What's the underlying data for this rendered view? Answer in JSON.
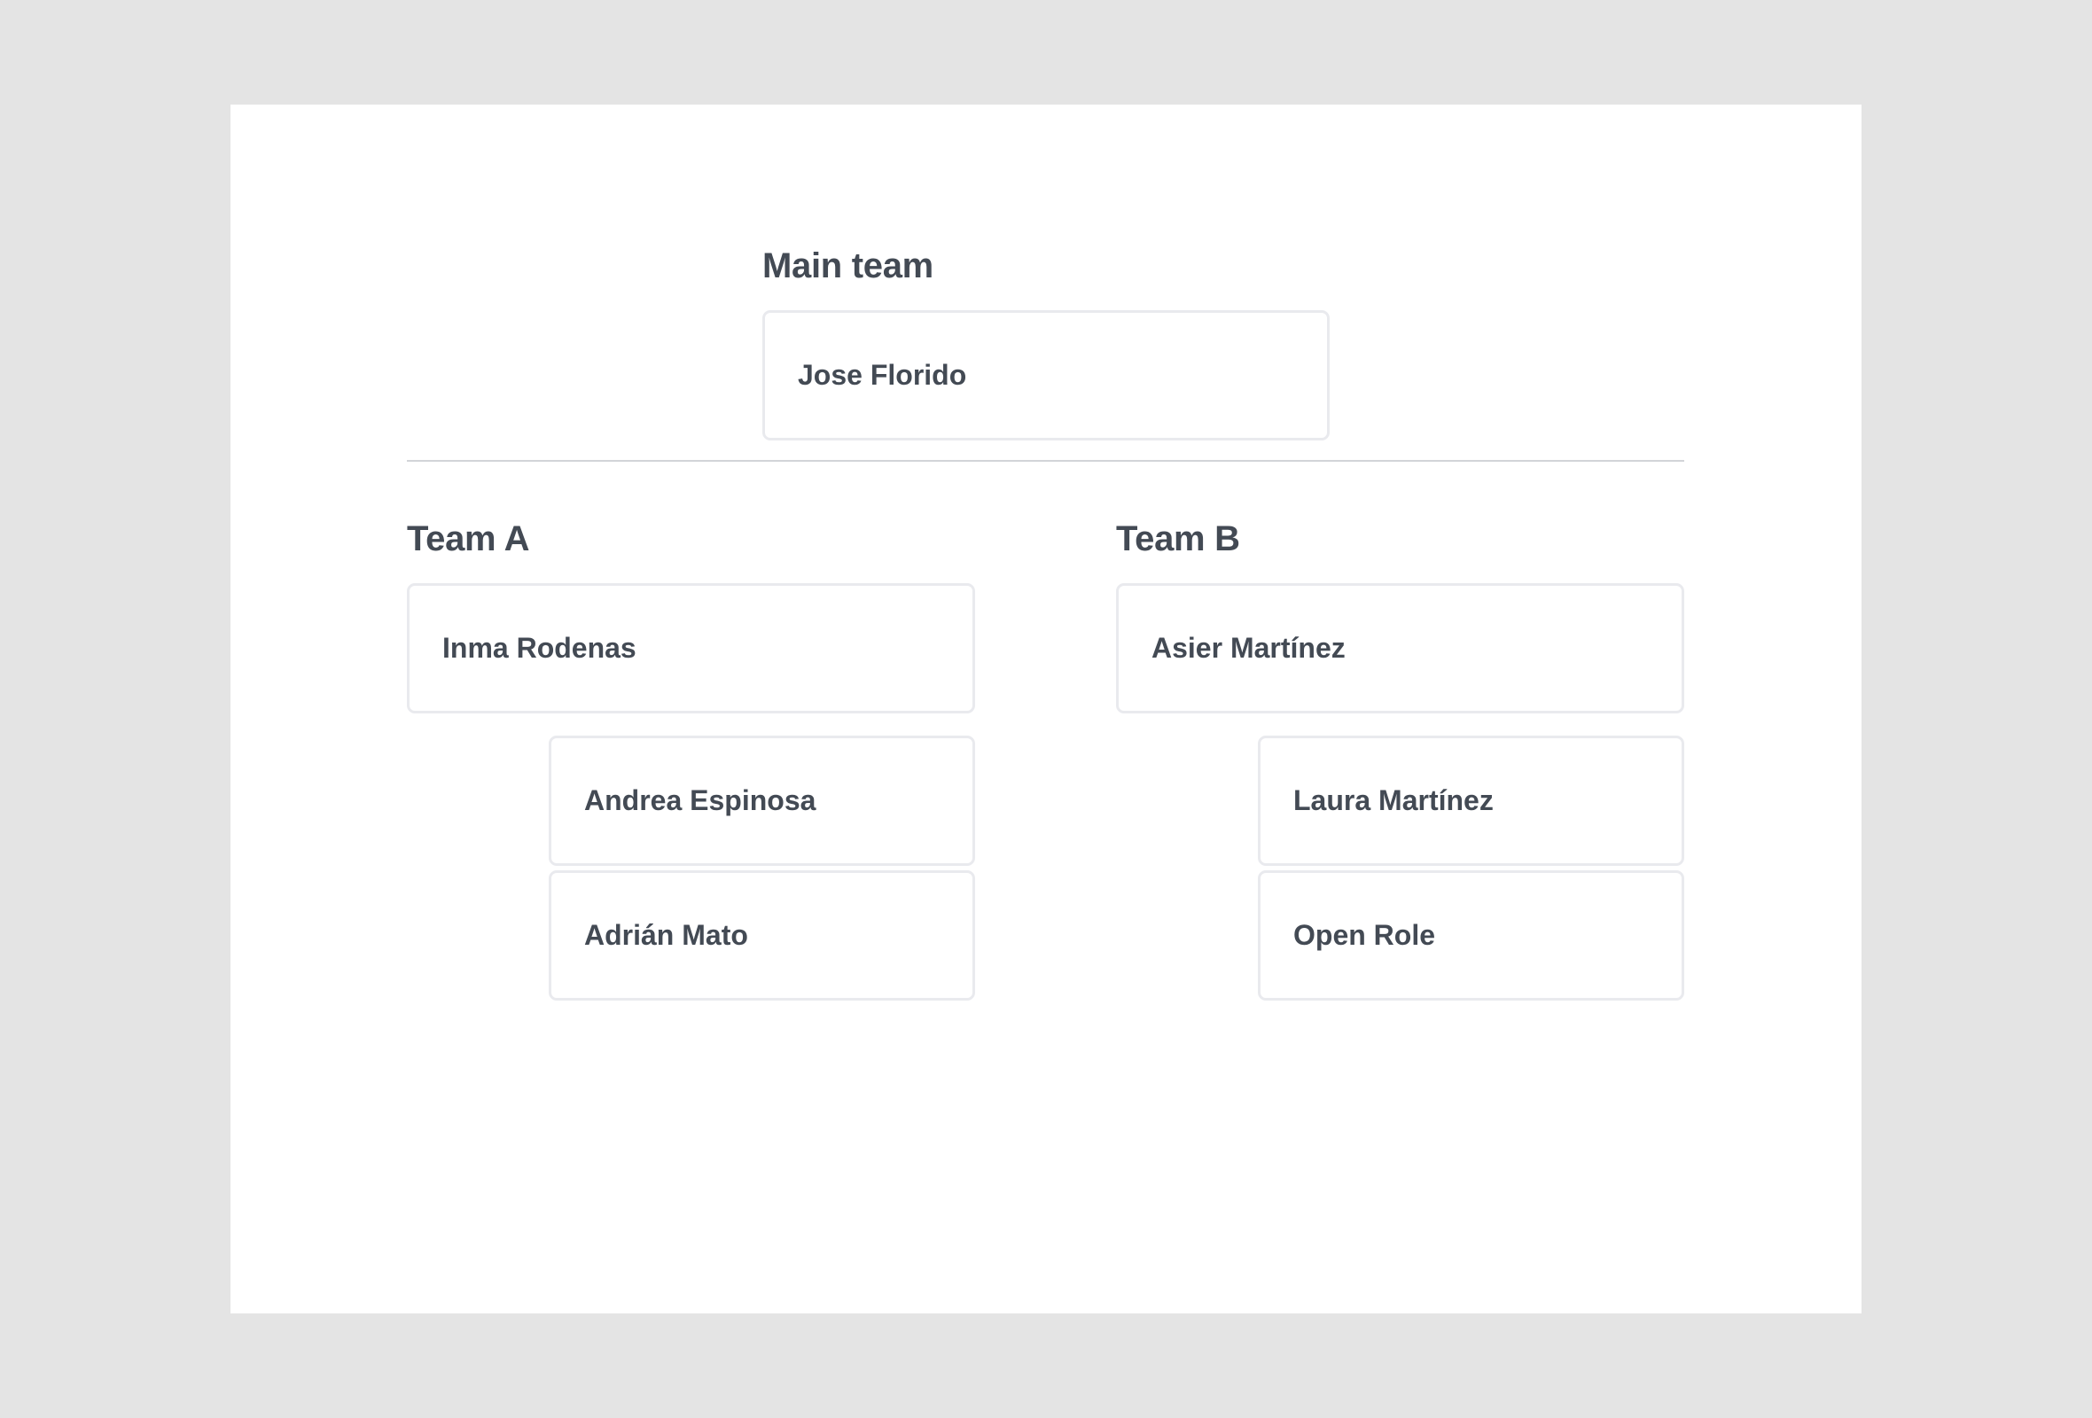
{
  "main_team": {
    "title": "Main team",
    "members": [
      "Jose Florido"
    ]
  },
  "team_a": {
    "title": "Team A",
    "lead": "Inma Rodenas",
    "members": [
      "Andrea Espinosa",
      "Adrián Mato"
    ]
  },
  "team_b": {
    "title": "Team B",
    "lead": "Asier Martínez",
    "members": [
      "Laura Martínez",
      "Open Role"
    ]
  },
  "colors": {
    "background": "#e4e4e4",
    "canvas": "#ffffff",
    "text": "#434a54",
    "card_border": "#e9eaee",
    "divider": "#d2d4d8"
  }
}
